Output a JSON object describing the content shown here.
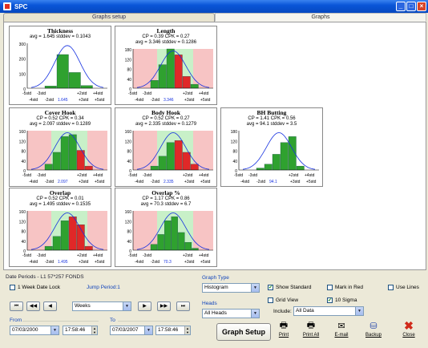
{
  "window": {
    "title": "SPC"
  },
  "tabs": {
    "setup": "Graphs setup",
    "graphs": "Graphs"
  },
  "colors": {
    "bar_green": "#2fa12f",
    "bar_red": "#e02828",
    "bg_green": "#c8f0c8",
    "bg_red": "#f7c4c4",
    "curve": "#1530e0"
  },
  "charts": [
    {
      "title": "Thickness",
      "line1": "avg = 1.645  stddev = 0.1043",
      "line2": "",
      "yticks": [
        "300",
        "200",
        "100",
        "0"
      ],
      "lsl_line": "",
      "xlab_top_left": "-5std",
      "xlab_top_mid": "-3std",
      "xlab_top_r1": "+2std",
      "xlab_top_r2": "+4std",
      "xlab_bot_l1": "-4std",
      "xlab_bot_l2": "-2std",
      "xlab_avg": "1.645",
      "xlab_bot_r1": "+3std",
      "xlab_bot_r2": "+5std"
    },
    {
      "title": "Length",
      "line1": "CP = 0.39  CPK = 0.27",
      "line2": "avg = 3.346  stddev = 0.1286",
      "yticks": [
        "180",
        "120",
        "80",
        "40",
        "0"
      ],
      "xlab_top_left": "-5std",
      "xlab_top_mid": "-3std",
      "xlab_top_r1": "+2std",
      "xlab_top_r2": "+4std",
      "xlab_bot_l1": "-4std",
      "xlab_bot_l2": "-2std",
      "xlab_avg": "3.346",
      "xlab_bot_r1": "+3std",
      "xlab_bot_r2": "+5std"
    },
    {
      "title": "Cover Hook",
      "line1": "CP = 0.52  CPK = 0.34",
      "line2": "avg = 2.097  stddev = 0.1289",
      "yticks": [
        "160",
        "120",
        "80",
        "40",
        "0"
      ],
      "xlab_top_left": "-5std",
      "xlab_top_mid": "-3std",
      "xlab_top_r1": "+2std",
      "xlab_top_r2": "+4std",
      "xlab_bot_l1": "-4std",
      "xlab_bot_l2": "-2std",
      "xlab_avg": "2.097",
      "xlab_bot_r1": "+3std",
      "xlab_bot_r2": "+5std"
    },
    {
      "title": "Body Hook",
      "line1": "CP = 0.52  CPK = 0.27",
      "line2": "avg = 2.335  stddev = 0.1279",
      "yticks": [
        "160",
        "120",
        "80",
        "40",
        "0"
      ],
      "xlab_top_left": "-5std",
      "xlab_top_mid": "-3std",
      "xlab_top_r1": "+2std",
      "xlab_top_r2": "+4std",
      "xlab_bot_l1": "-4std",
      "xlab_bot_l2": "-2std",
      "xlab_avg": "2.335",
      "xlab_bot_r1": "+3std",
      "xlab_bot_r2": "+5std"
    },
    {
      "title": "BH Butting",
      "line1": "CP = 1.41  CPK = 0.56",
      "line2": "avg = 94.1  stddev = 3.5",
      "yticks": [
        "180",
        "120",
        "80",
        "40",
        "0"
      ],
      "xlab_top_left": "-5std",
      "xlab_top_mid": "-3std",
      "xlab_top_r1": "+2std",
      "xlab_top_r2": "+4std",
      "xlab_bot_l1": "-4std",
      "xlab_bot_l2": "-2std",
      "xlab_avg": "94.1",
      "xlab_bot_r1": "+3std",
      "xlab_bot_r2": "+5std"
    },
    {
      "title": "Overlap",
      "line1": "CP = 0.52  CPK = 0.01",
      "line2": "avg = 1.495  stddev = 0.1535",
      "yticks": [
        "160",
        "120",
        "80",
        "40",
        "0"
      ],
      "xlab_top_left": "-5std",
      "xlab_top_mid": "-3std",
      "xlab_top_r1": "+2std",
      "xlab_top_r2": "+4std",
      "xlab_bot_l1": "-4std",
      "xlab_bot_l2": "-2std",
      "xlab_avg": "1.495",
      "xlab_bot_r1": "+3std",
      "xlab_bot_r2": "+5std"
    },
    {
      "title": "Overlap %",
      "line1": "CP = 1.17  CPK = 0.86",
      "line2": "avg = 70.3  stddev = 6.7",
      "yticks": [
        "160",
        "120",
        "80",
        "40",
        "0"
      ],
      "xlab_top_left": "-5std",
      "xlab_top_mid": "-3std",
      "xlab_top_r1": "+2std",
      "xlab_top_r2": "+4std",
      "xlab_bot_l1": "-4std",
      "xlab_bot_l2": "-2std",
      "xlab_avg": "70.3",
      "xlab_bot_r1": "+3std",
      "xlab_bot_r2": "+5std"
    }
  ],
  "controls": {
    "date_periods": "Date Periods - L1  57*257 FONDS",
    "week_lock": "1 Week Date Lock",
    "jump_period": "Jump Period:1",
    "period_value": "Weeks",
    "from_label": "From",
    "to_label": "To",
    "from_date": "07/03/2000",
    "from_time": "17:58:46",
    "to_date": "07/03/2007",
    "to_time": "17:58:46",
    "graph_type_label": "Graph Type",
    "graph_type_value": "Histogram",
    "heads_label": "Heads",
    "heads_value": "All Heads",
    "show_standard": "Show Standard",
    "mark_in_red": "Mark in Red",
    "use_lines": "Use Lines",
    "grid_view": "Grid View",
    "ten_sigma": "10 Sigma",
    "include_label": "Include:",
    "include_value": "All Data",
    "graph_setup_button": "Graph Setup",
    "print_button": "Print",
    "print_all_button": "Print All",
    "email_button": "E-mail",
    "backup_button": "Backup",
    "close_button": "Close",
    "nav_first": "⏮",
    "nav_prev2": "◀◀",
    "nav_prev": "◀",
    "nav_next": "▶",
    "nav_next2": "▶▶",
    "nav_last": "⏭"
  }
}
